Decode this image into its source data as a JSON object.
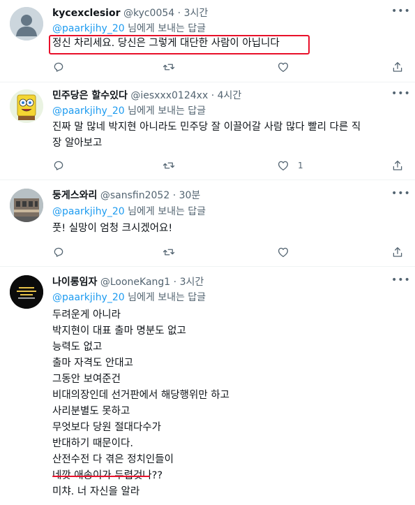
{
  "tweets": [
    {
      "name": "kycexclesior",
      "handle": "@kyc0054",
      "dot": "·",
      "time": "3시간",
      "reply_to": "@paarkjihy_20",
      "reply_suffix": " 님에게 보내는 답글",
      "text": "정신 차리세요. 당신은 그렇게 대단한 사람이 아닙니다",
      "like_count": ""
    },
    {
      "name": "민주당은 할수있다",
      "handle": "@iesxxx0124xx",
      "dot": "·",
      "time": "4시간",
      "reply_to": "@paarkjihy_20",
      "reply_suffix": " 님에게 보내는 답글",
      "text": "진짜 말 많네  박지현 아니라도 민주당 잘 이끌어갈 사람 많다  빨리 다른 직\n장 알아보고",
      "like_count": "1"
    },
    {
      "name": "둥게스와리",
      "handle": "@sansfin2052",
      "dot": "·",
      "time": "30분",
      "reply_to": "@paarkjihy_20",
      "reply_suffix": " 님에게 보내는 답글",
      "text": "풋! 실망이 엄청 크시겠어요!",
      "like_count": ""
    },
    {
      "name": "나이롱임자",
      "handle": "@LooneKang1",
      "dot": "·",
      "time": "3시간",
      "reply_to": "@paarkjihy_20",
      "reply_suffix": " 님에게 보내는 답글",
      "text": "두려운게 아니라\n박지현이 대표 출마 명분도 없고\n능력도 없고\n출마 자격도 안대고\n그동안 보여준건\n비대의장인데 선거판에서 해당행위만 하고\n사리분별도 못하고\n무엇보다 당원 절대다수가\n반대하기 때문이다.\n산전수전 다 겪은 정치인들이\n네깟 애송이가 두렵것나??\n미챠. 너 자신을 알라",
      "like_count": ""
    }
  ],
  "colors": {
    "link": "#1d9bf0",
    "muted": "#536471",
    "highlight": "#e8102a"
  },
  "icons": [
    "reply-icon",
    "retweet-icon",
    "like-icon",
    "share-icon",
    "more-icon"
  ]
}
